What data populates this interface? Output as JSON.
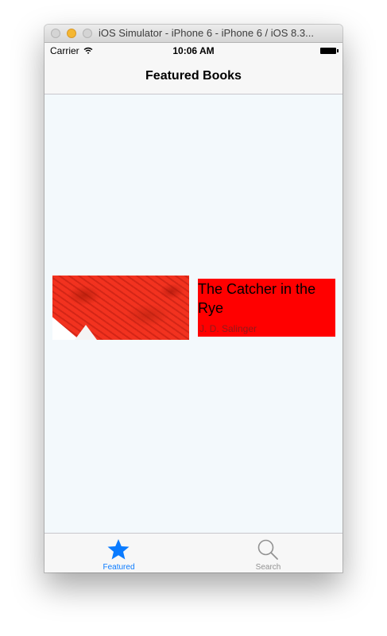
{
  "window": {
    "title": "iOS Simulator - iPhone 6 - iPhone 6 / iOS 8.3..."
  },
  "statusbar": {
    "carrier": "Carrier",
    "time": "10:06 AM"
  },
  "navbar": {
    "title": "Featured Books"
  },
  "books": [
    {
      "title": "The Catcher in the Rye",
      "author": "J. D. Salinger"
    }
  ],
  "tabbar": {
    "items": [
      {
        "label": "Featured",
        "icon": "star-icon",
        "selected": true
      },
      {
        "label": "Search",
        "icon": "magnifier-icon",
        "selected": false
      }
    ]
  },
  "colors": {
    "accent": "#0a7bff",
    "cell_background": "#ff0000",
    "content_background": "#f3f9fc"
  }
}
